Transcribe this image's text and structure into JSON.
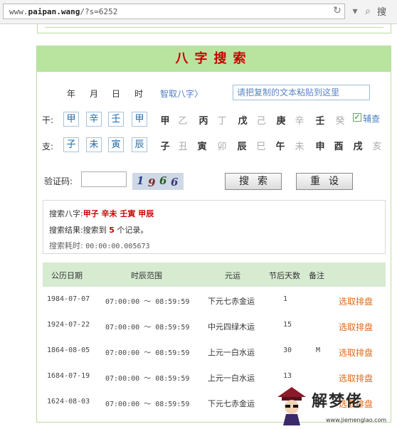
{
  "browser": {
    "url_prefix": "www.",
    "url_host": "paipan.wang",
    "url_path": "/?s=6252",
    "search_glyph": "搜"
  },
  "panel": {
    "title": "八字搜索"
  },
  "columns": [
    "年",
    "月",
    "日",
    "时"
  ],
  "fetch_link": "智取八字〉",
  "paste_placeholder": "请把复制的文本粘贴到这里",
  "stem_label": "干:",
  "branch_label": "支:",
  "stem_selects": [
    "甲",
    "辛",
    "壬",
    "甲"
  ],
  "branch_selects": [
    "子",
    "未",
    "寅",
    "辰"
  ],
  "stems": [
    {
      "t": "甲",
      "on": true
    },
    {
      "t": "乙",
      "on": false
    },
    {
      "t": "丙",
      "on": true
    },
    {
      "t": "丁",
      "on": false
    },
    {
      "t": "戊",
      "on": true
    },
    {
      "t": "己",
      "on": false
    },
    {
      "t": "庚",
      "on": true
    },
    {
      "t": "辛",
      "on": false
    },
    {
      "t": "壬",
      "on": true
    },
    {
      "t": "癸",
      "on": false
    }
  ],
  "branches": [
    {
      "t": "子",
      "on": true
    },
    {
      "t": "丑",
      "on": false
    },
    {
      "t": "寅",
      "on": true
    },
    {
      "t": "卯",
      "on": false
    },
    {
      "t": "辰",
      "on": true
    },
    {
      "t": "巳",
      "on": false
    },
    {
      "t": "午",
      "on": true
    },
    {
      "t": "未",
      "on": false
    },
    {
      "t": "申",
      "on": true
    },
    {
      "t": "酉",
      "on": true
    },
    {
      "t": "戌",
      "on": true
    },
    {
      "t": "亥",
      "on": false
    }
  ],
  "aux_checkbox": {
    "label": "辅查",
    "checked": true
  },
  "verify": {
    "label": "验证码:",
    "captcha": [
      "1",
      "9",
      "6",
      "6"
    ]
  },
  "buttons": {
    "search": "搜索",
    "reset": "重设"
  },
  "summary": {
    "bazi_label": "搜索八字:",
    "bazi_value": "甲子 辛未 壬寅 甲辰",
    "result_prefix": "搜索结果:搜索到",
    "result_count": "5",
    "result_suffix": "个记录。",
    "time_label": "搜索耗时:",
    "time_value": "00:00:00.005673"
  },
  "table": {
    "headers": [
      "公历日期",
      "时辰范围",
      "元运",
      "节后天数",
      "备注"
    ],
    "rows": [
      {
        "date": "1984-07-07",
        "range": "07:00:00 ～ 08:59:59",
        "yun": "下元七赤金运",
        "days": "1",
        "note": "",
        "action": "选取排盘"
      },
      {
        "date": "1924-07-22",
        "range": "07:00:00 ～ 08:59:59",
        "yun": "中元四绿木运",
        "days": "15",
        "note": "",
        "action": "选取排盘"
      },
      {
        "date": "1864-08-05",
        "range": "07:00:00 ～ 08:59:59",
        "yun": "上元一白水运",
        "days": "30",
        "note": "M",
        "action": "选取排盘"
      },
      {
        "date": "1684-07-19",
        "range": "07:00:00 ～ 08:59:59",
        "yun": "上元一白水运",
        "days": "13",
        "note": "",
        "action": "选取排盘"
      },
      {
        "date": "1624-08-03",
        "range": "07:00:00 ～ 08:59:59",
        "yun": "下元七赤金运",
        "days": "",
        "note": "",
        "action": "选取排盘"
      }
    ]
  },
  "watermark": {
    "text": "解梦佬",
    "url": "www.jiemenglao.com"
  },
  "colors": {
    "title_bg": "#b8e4a0",
    "title_text": "#cc0000",
    "table_head_bg": "#d6ebd0",
    "link": "#4f7fc1",
    "action": "#e06a1a"
  }
}
